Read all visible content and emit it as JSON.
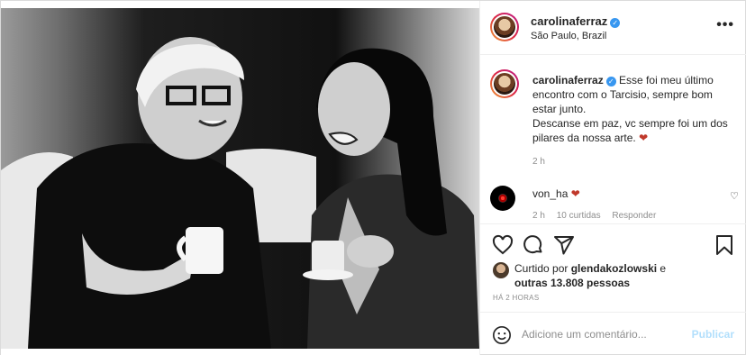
{
  "post": {
    "author": "carolinaferraz",
    "location": "São Paulo, Brazil",
    "more_label": "•••"
  },
  "caption": {
    "username": "carolinaferraz",
    "text_line1": "Esse foi meu último encontro com o Tarcisio, sempre bom estar junto.",
    "text_line2": "Descanse em paz, vc sempre foi um dos pilares da nossa arte.",
    "heart": "❤",
    "time_ago": "2 h"
  },
  "comment": {
    "username": "von_ha",
    "heart": "❤",
    "time_ago": "2 h",
    "likes": "10 curtidas",
    "reply_label": "Responder",
    "like_icon": "♡"
  },
  "likes": {
    "prefix": "Curtido por",
    "user": "glendakozlowski",
    "connector": "e",
    "others": "outras 13.808 pessoas"
  },
  "timestamp": "HÁ 2 HORAS",
  "add_comment": {
    "placeholder": "Adicione um comentário...",
    "publish_label": "Publicar"
  },
  "icons": [
    "heart-icon",
    "comment-icon",
    "share-icon",
    "bookmark-icon",
    "emoji-icon",
    "verified-icon",
    "more-icon"
  ],
  "colors": {
    "verified": "#3897f0",
    "publish_disabled": "#b2dffc",
    "heart_red": "#c0392b",
    "muted": "#8e8e8e"
  }
}
